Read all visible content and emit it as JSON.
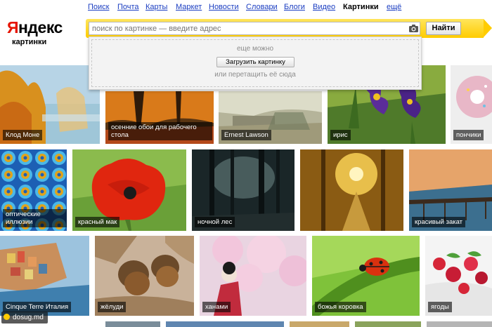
{
  "nav": {
    "items": [
      "Поиск",
      "Почта",
      "Карты",
      "Маркет",
      "Новости",
      "Словари",
      "Блоги",
      "Видео"
    ],
    "current": "Картинки",
    "more": "ещё"
  },
  "logo": {
    "first_letter": "Я",
    "rest": "ндекс",
    "subtitle": "картинки"
  },
  "search": {
    "placeholder": "поиск по картинке — введите адрес",
    "button_label": "Найти",
    "camera_icon": "camera-icon"
  },
  "upload": {
    "line1": "еще можно",
    "button_label": "Загрузить картинку",
    "line3": "или перетащить её сюда"
  },
  "tiles": [
    [
      "Клод Моне",
      "осенние обои для рабочего стола",
      "Ernest Lawson",
      "ирис",
      "пончики"
    ],
    [
      "оптические иллюзии",
      "красный мак",
      "ночной лес",
      "",
      "красивый закат"
    ],
    [
      "Cinque Terre Италия",
      "жёлуди",
      "ханами",
      "божья коровка",
      "ягоды"
    ]
  ],
  "watermark": "dosug.md",
  "colors": {
    "link": "#1a3dc1",
    "logo_red": "#e61400",
    "search_yellow": "#ffcc00"
  }
}
